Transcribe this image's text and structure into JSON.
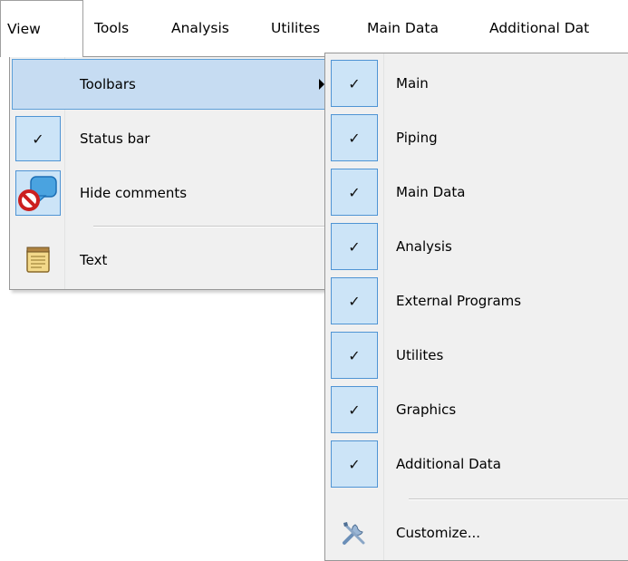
{
  "menubar": {
    "items": [
      {
        "label": "View"
      },
      {
        "label": "Tools"
      },
      {
        "label": "Analysis"
      },
      {
        "label": "Utilites"
      },
      {
        "label": "Main Data"
      },
      {
        "label": "Additional Dat"
      }
    ]
  },
  "view_menu": {
    "items": [
      {
        "label": "Toolbars",
        "icon": "none",
        "has_submenu": true,
        "highlighted": true
      },
      {
        "label": "Status bar",
        "icon": "check-icon",
        "checked": true
      },
      {
        "label": "Hide comments",
        "icon": "hide-comments-icon",
        "checked": true
      },
      {
        "label": "Text",
        "icon": "notepad-icon",
        "checked": false
      }
    ]
  },
  "toolbars_submenu": {
    "items": [
      {
        "label": "Main",
        "checked": true
      },
      {
        "label": "Piping",
        "checked": true
      },
      {
        "label": "Main Data",
        "checked": true
      },
      {
        "label": "Analysis",
        "checked": true
      },
      {
        "label": "External Programs",
        "checked": true
      },
      {
        "label": "Utilites",
        "checked": true
      },
      {
        "label": "Graphics",
        "checked": true
      },
      {
        "label": "Additional Data",
        "checked": true
      },
      {
        "label": "Customize...",
        "icon": "tools-icon",
        "checked": false
      }
    ],
    "check_glyph": "✓"
  },
  "colors": {
    "highlight_bg": "#c6dcf2",
    "highlight_border": "#5ea0d8",
    "check_bg": "#cce4f7",
    "check_border": "#4f94d4",
    "menu_bg": "#f0f0f0"
  }
}
